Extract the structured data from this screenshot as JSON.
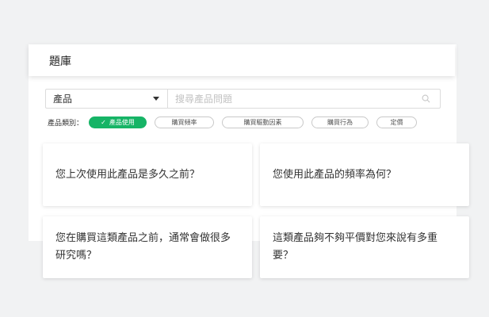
{
  "panel": {
    "title": "題庫"
  },
  "search": {
    "category_selected": "產品",
    "placeholder": "搜尋產品問題"
  },
  "filters": {
    "label": "產品類別：",
    "chips": [
      {
        "label": "產品使用",
        "active": true
      },
      {
        "label": "購買頻率",
        "active": false
      },
      {
        "label": "購買驅動因素",
        "active": false
      },
      {
        "label": "購買行為",
        "active": false
      },
      {
        "label": "定價",
        "active": false
      }
    ]
  },
  "questions": [
    "您上次使用此產品是多久之前？",
    "您使用此產品的頻率為何？",
    "您在購買這類產品之前，通常會做很多研究嗎？",
    "這類產品夠不夠平價對您來說有多重要？"
  ],
  "colors": {
    "accent": "#16b466",
    "background": "#f1f2f3"
  }
}
